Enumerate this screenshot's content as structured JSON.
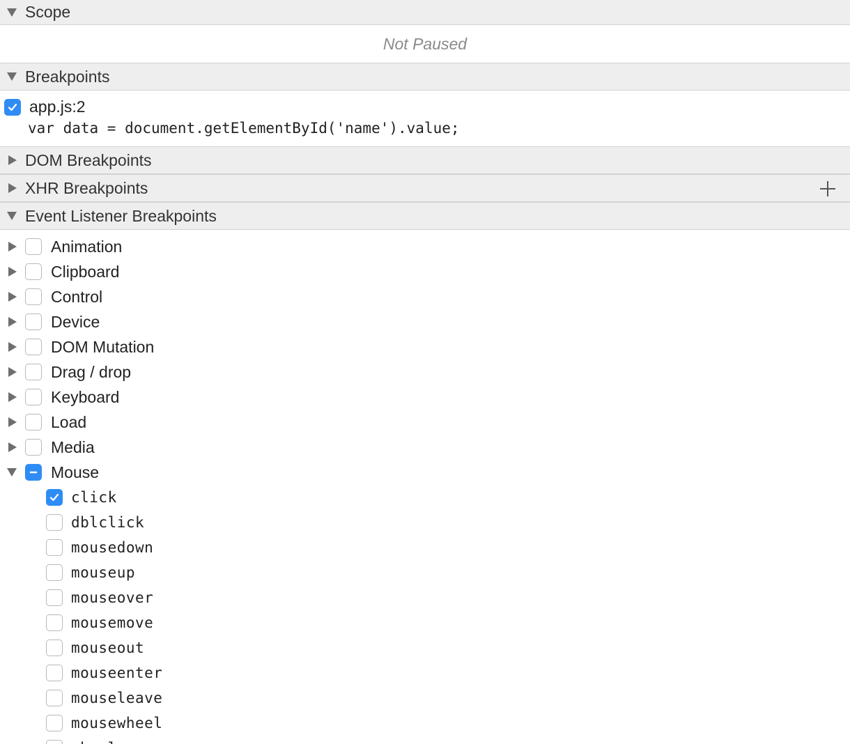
{
  "scope": {
    "title": "Scope",
    "status": "Not Paused"
  },
  "breakpoints": {
    "title": "Breakpoints",
    "items": [
      {
        "location": "app.js:2",
        "code": "var data = document.getElementById('name').value;",
        "checked": true
      }
    ]
  },
  "dom_breakpoints": {
    "title": "DOM Breakpoints"
  },
  "xhr_breakpoints": {
    "title": "XHR Breakpoints",
    "add_icon": "plus-icon"
  },
  "event_listener_breakpoints": {
    "title": "Event Listener Breakpoints",
    "categories": [
      {
        "label": "Animation",
        "expanded": false,
        "state": "unchecked"
      },
      {
        "label": "Clipboard",
        "expanded": false,
        "state": "unchecked"
      },
      {
        "label": "Control",
        "expanded": false,
        "state": "unchecked"
      },
      {
        "label": "Device",
        "expanded": false,
        "state": "unchecked"
      },
      {
        "label": "DOM Mutation",
        "expanded": false,
        "state": "unchecked"
      },
      {
        "label": "Drag / drop",
        "expanded": false,
        "state": "unchecked"
      },
      {
        "label": "Keyboard",
        "expanded": false,
        "state": "unchecked"
      },
      {
        "label": "Load",
        "expanded": false,
        "state": "unchecked"
      },
      {
        "label": "Media",
        "expanded": false,
        "state": "unchecked"
      },
      {
        "label": "Mouse",
        "expanded": true,
        "state": "mixed"
      }
    ],
    "mouse_events": [
      {
        "label": "click",
        "checked": true
      },
      {
        "label": "dblclick",
        "checked": false
      },
      {
        "label": "mousedown",
        "checked": false
      },
      {
        "label": "mouseup",
        "checked": false
      },
      {
        "label": "mouseover",
        "checked": false
      },
      {
        "label": "mousemove",
        "checked": false
      },
      {
        "label": "mouseout",
        "checked": false
      },
      {
        "label": "mouseenter",
        "checked": false
      },
      {
        "label": "mouseleave",
        "checked": false
      },
      {
        "label": "mousewheel",
        "checked": false
      },
      {
        "label": "wheel",
        "checked": false
      }
    ]
  },
  "colors": {
    "checkbox_accent": "#2f8cf5",
    "header_bg": "#eeeeee",
    "muted_text": "#8a8a8a"
  }
}
